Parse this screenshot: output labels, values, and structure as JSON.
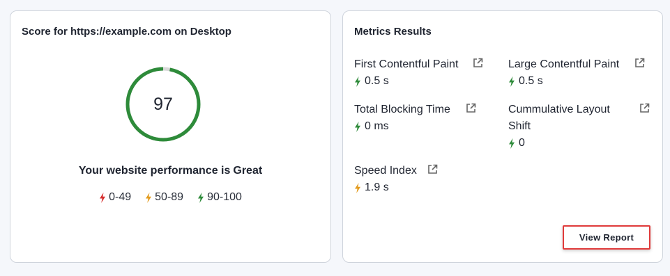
{
  "score_card": {
    "title": "Score for https://example.com on Desktop",
    "score": "97",
    "score_fraction": 0.97,
    "performance_prefix": "Your website performance is",
    "performance_rating": "Great",
    "legend": [
      {
        "range": "0-49",
        "color": "#d62d2d",
        "icon": "bolt-icon"
      },
      {
        "range": "50-89",
        "color": "#e39b1e",
        "icon": "bolt-icon"
      },
      {
        "range": "90-100",
        "color": "#2e8b3a",
        "icon": "bolt-icon"
      }
    ],
    "gauge_color": "#2e8b3a",
    "gauge_track_color": "#d9d9d9"
  },
  "metrics_card": {
    "title": "Metrics Results",
    "metrics": [
      {
        "name": "First Contentful Paint",
        "value": "0.5 s",
        "status": "good"
      },
      {
        "name": "Large Contentful Paint",
        "value": "0.5 s",
        "status": "good"
      },
      {
        "name": "Total Blocking Time",
        "value": "0 ms",
        "status": "good"
      },
      {
        "name_line1": "Cummulative Layout",
        "name_line2": "Shift",
        "value": "0",
        "status": "good"
      },
      {
        "name": "Speed Index",
        "value": "1.9 s",
        "status": "average"
      }
    ],
    "view_report_label": "View Report",
    "status_colors": {
      "good": "#2e8b3a",
      "average": "#e39b1e",
      "poor": "#d62d2d"
    },
    "icons": {
      "external_link": "external-link-icon",
      "status": "bolt-icon"
    }
  }
}
